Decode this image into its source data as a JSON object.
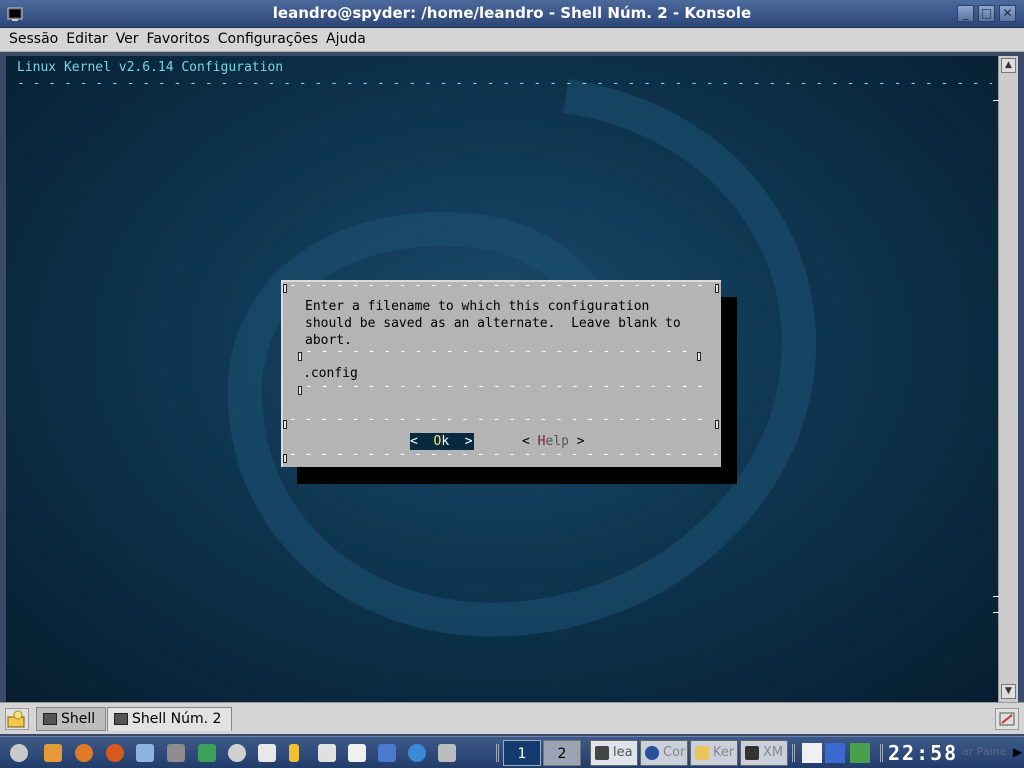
{
  "window": {
    "title": "leandro@spyder: /home/leandro - Shell Núm. 2 - Konsole",
    "controls": {
      "minimize": "_",
      "maximize": "□",
      "close": "✕"
    }
  },
  "menubar": [
    "Sessão",
    "Editar",
    "Ver",
    "Favoritos",
    "Configurações",
    "Ajuda"
  ],
  "terminal": {
    "header": "Linux Kernel v2.6.14 Configuration",
    "dialog": {
      "prompt": "Enter a filename to which this configuration\nshould be saved as an alternate.  Leave blank to\nabort.",
      "input_value": ".config",
      "ok_button": {
        "left": "<  ",
        "hot": "O",
        "rest": "k",
        "right": "  >"
      },
      "help_button": {
        "left": "< ",
        "hot": "H",
        "rest": "elp",
        "right": " >"
      }
    }
  },
  "tabs": [
    {
      "label": "Shell",
      "active": false
    },
    {
      "label": "Shell Núm. 2",
      "active": true
    }
  ],
  "taskbar": {
    "pager": [
      "1",
      "2"
    ],
    "tasks": [
      {
        "label": "lea",
        "icon": "konsole-icon"
      },
      {
        "label": "Cor",
        "icon": "browser-icon"
      },
      {
        "label": "Ker",
        "icon": "folder-icon"
      },
      {
        "label": "XM",
        "icon": "xmms-icon"
      }
    ],
    "clock": "22:58",
    "panel_label": "ar Paine"
  },
  "colors": {
    "terminal_bg": "#0e3550",
    "dialog_bg": "#b4b4b4",
    "title_text": "#7ad4e6",
    "selected_button": "#082a40",
    "hotkey_yellow": "#ffe64a"
  }
}
